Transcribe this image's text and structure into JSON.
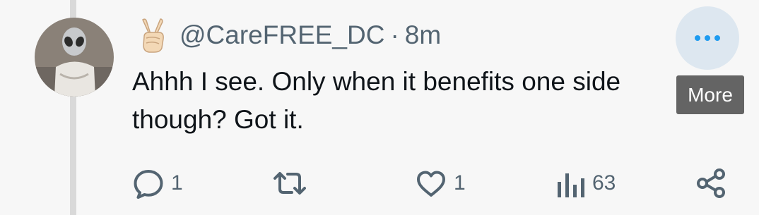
{
  "tweet": {
    "handle": "@CareFREE_DC",
    "separator": "·",
    "time": "8m",
    "text": "Ahhh I see. Only when it benefits one side though? Got it."
  },
  "more_tooltip": "More",
  "actions": {
    "reply_count": "1",
    "like_count": "1",
    "views_count": "63"
  },
  "icons": {
    "author_emoji": "victory-hand-icon",
    "avatar_emoji": "alien-icon",
    "more": "ellipsis-icon",
    "reply": "speech-bubble-icon",
    "retweet": "retweet-icon",
    "like": "heart-icon",
    "views": "bar-chart-icon",
    "share": "share-icon"
  },
  "colors": {
    "background": "#f7f7f7",
    "secondary_text": "#536471",
    "primary_text": "#0f1419",
    "more_accent": "#1d9bf0",
    "tooltip_bg": "#585858"
  }
}
